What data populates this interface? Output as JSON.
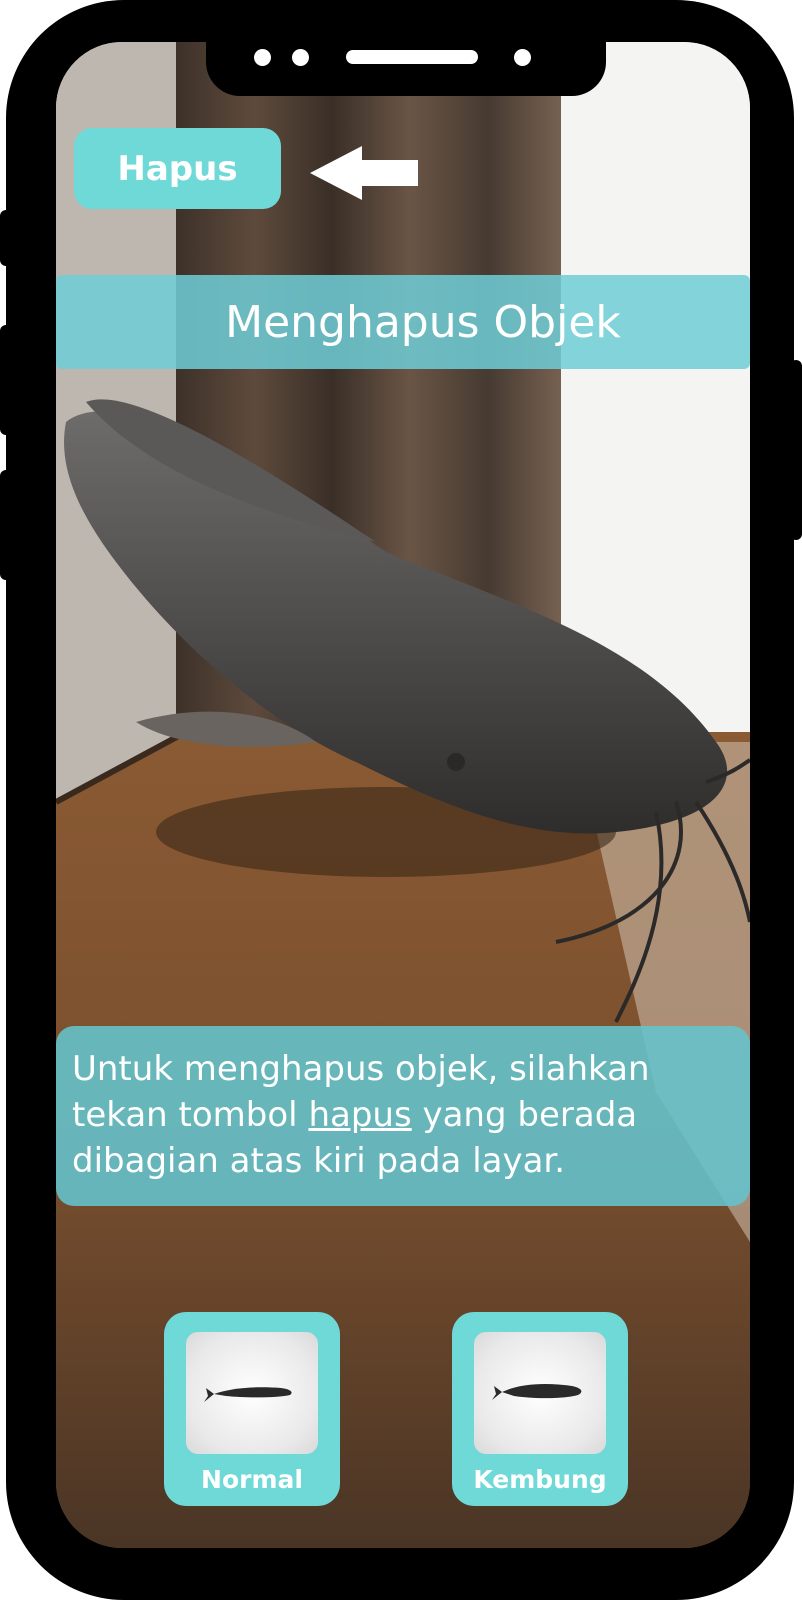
{
  "header": {
    "delete_button_label": "Hapus"
  },
  "title_bar": {
    "title": "Menghapus Objek"
  },
  "instruction": {
    "text_before": "Untuk menghapus objek, silahkan tekan tombol ",
    "highlight": "hapus",
    "text_after": " yang berada dibagian atas kiri pada layar."
  },
  "model_selector": {
    "options": [
      {
        "label": "Normal",
        "icon": "catfish-thumbnail-icon"
      },
      {
        "label": "Kembung",
        "icon": "catfish-thumbnail-icon"
      }
    ]
  },
  "colors": {
    "accent": "#6fd9d8",
    "panel": "#64c4ce",
    "frame": "#000000"
  }
}
